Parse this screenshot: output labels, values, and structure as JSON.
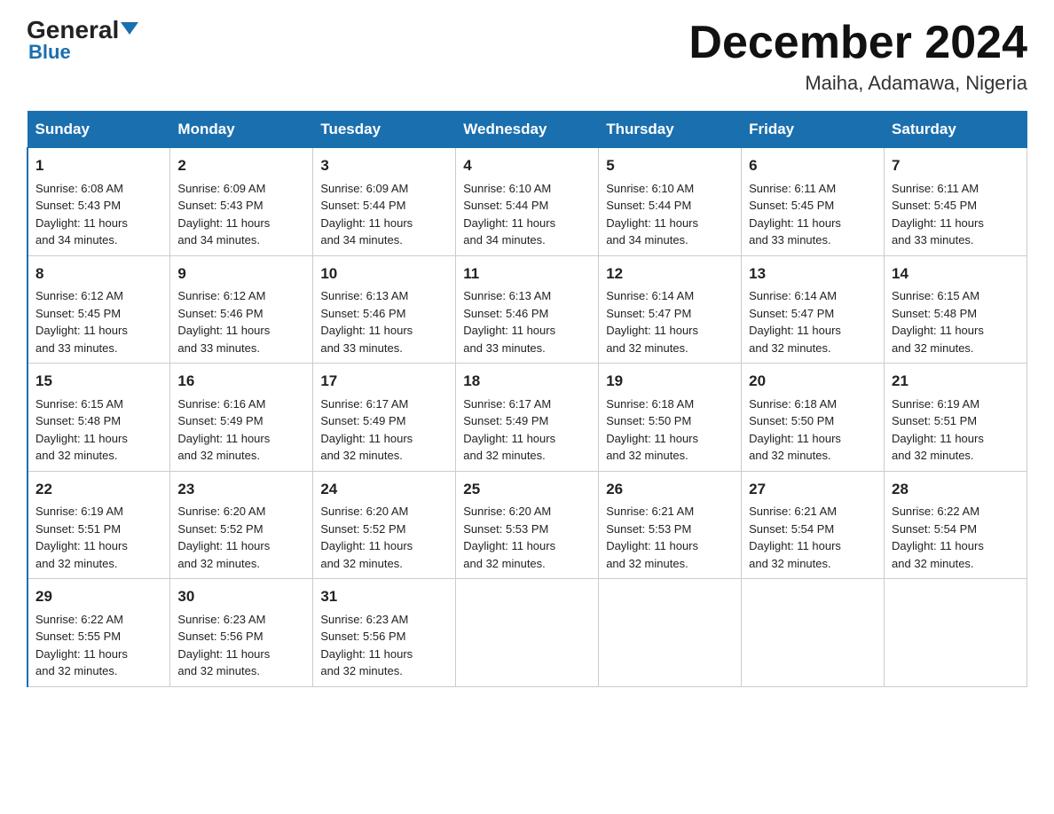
{
  "header": {
    "logo_general": "General",
    "logo_blue": "Blue",
    "month_title": "December 2024",
    "location": "Maiha, Adamawa, Nigeria"
  },
  "days_of_week": [
    "Sunday",
    "Monday",
    "Tuesday",
    "Wednesday",
    "Thursday",
    "Friday",
    "Saturday"
  ],
  "weeks": [
    [
      {
        "day": "1",
        "sunrise": "6:08 AM",
        "sunset": "5:43 PM",
        "daylight": "11 hours and 34 minutes."
      },
      {
        "day": "2",
        "sunrise": "6:09 AM",
        "sunset": "5:43 PM",
        "daylight": "11 hours and 34 minutes."
      },
      {
        "day": "3",
        "sunrise": "6:09 AM",
        "sunset": "5:44 PM",
        "daylight": "11 hours and 34 minutes."
      },
      {
        "day": "4",
        "sunrise": "6:10 AM",
        "sunset": "5:44 PM",
        "daylight": "11 hours and 34 minutes."
      },
      {
        "day": "5",
        "sunrise": "6:10 AM",
        "sunset": "5:44 PM",
        "daylight": "11 hours and 34 minutes."
      },
      {
        "day": "6",
        "sunrise": "6:11 AM",
        "sunset": "5:45 PM",
        "daylight": "11 hours and 33 minutes."
      },
      {
        "day": "7",
        "sunrise": "6:11 AM",
        "sunset": "5:45 PM",
        "daylight": "11 hours and 33 minutes."
      }
    ],
    [
      {
        "day": "8",
        "sunrise": "6:12 AM",
        "sunset": "5:45 PM",
        "daylight": "11 hours and 33 minutes."
      },
      {
        "day": "9",
        "sunrise": "6:12 AM",
        "sunset": "5:46 PM",
        "daylight": "11 hours and 33 minutes."
      },
      {
        "day": "10",
        "sunrise": "6:13 AM",
        "sunset": "5:46 PM",
        "daylight": "11 hours and 33 minutes."
      },
      {
        "day": "11",
        "sunrise": "6:13 AM",
        "sunset": "5:46 PM",
        "daylight": "11 hours and 33 minutes."
      },
      {
        "day": "12",
        "sunrise": "6:14 AM",
        "sunset": "5:47 PM",
        "daylight": "11 hours and 32 minutes."
      },
      {
        "day": "13",
        "sunrise": "6:14 AM",
        "sunset": "5:47 PM",
        "daylight": "11 hours and 32 minutes."
      },
      {
        "day": "14",
        "sunrise": "6:15 AM",
        "sunset": "5:48 PM",
        "daylight": "11 hours and 32 minutes."
      }
    ],
    [
      {
        "day": "15",
        "sunrise": "6:15 AM",
        "sunset": "5:48 PM",
        "daylight": "11 hours and 32 minutes."
      },
      {
        "day": "16",
        "sunrise": "6:16 AM",
        "sunset": "5:49 PM",
        "daylight": "11 hours and 32 minutes."
      },
      {
        "day": "17",
        "sunrise": "6:17 AM",
        "sunset": "5:49 PM",
        "daylight": "11 hours and 32 minutes."
      },
      {
        "day": "18",
        "sunrise": "6:17 AM",
        "sunset": "5:49 PM",
        "daylight": "11 hours and 32 minutes."
      },
      {
        "day": "19",
        "sunrise": "6:18 AM",
        "sunset": "5:50 PM",
        "daylight": "11 hours and 32 minutes."
      },
      {
        "day": "20",
        "sunrise": "6:18 AM",
        "sunset": "5:50 PM",
        "daylight": "11 hours and 32 minutes."
      },
      {
        "day": "21",
        "sunrise": "6:19 AM",
        "sunset": "5:51 PM",
        "daylight": "11 hours and 32 minutes."
      }
    ],
    [
      {
        "day": "22",
        "sunrise": "6:19 AM",
        "sunset": "5:51 PM",
        "daylight": "11 hours and 32 minutes."
      },
      {
        "day": "23",
        "sunrise": "6:20 AM",
        "sunset": "5:52 PM",
        "daylight": "11 hours and 32 minutes."
      },
      {
        "day": "24",
        "sunrise": "6:20 AM",
        "sunset": "5:52 PM",
        "daylight": "11 hours and 32 minutes."
      },
      {
        "day": "25",
        "sunrise": "6:20 AM",
        "sunset": "5:53 PM",
        "daylight": "11 hours and 32 minutes."
      },
      {
        "day": "26",
        "sunrise": "6:21 AM",
        "sunset": "5:53 PM",
        "daylight": "11 hours and 32 minutes."
      },
      {
        "day": "27",
        "sunrise": "6:21 AM",
        "sunset": "5:54 PM",
        "daylight": "11 hours and 32 minutes."
      },
      {
        "day": "28",
        "sunrise": "6:22 AM",
        "sunset": "5:54 PM",
        "daylight": "11 hours and 32 minutes."
      }
    ],
    [
      {
        "day": "29",
        "sunrise": "6:22 AM",
        "sunset": "5:55 PM",
        "daylight": "11 hours and 32 minutes."
      },
      {
        "day": "30",
        "sunrise": "6:23 AM",
        "sunset": "5:56 PM",
        "daylight": "11 hours and 32 minutes."
      },
      {
        "day": "31",
        "sunrise": "6:23 AM",
        "sunset": "5:56 PM",
        "daylight": "11 hours and 32 minutes."
      },
      null,
      null,
      null,
      null
    ]
  ],
  "labels": {
    "sunrise": "Sunrise:",
    "sunset": "Sunset:",
    "daylight": "Daylight:"
  }
}
